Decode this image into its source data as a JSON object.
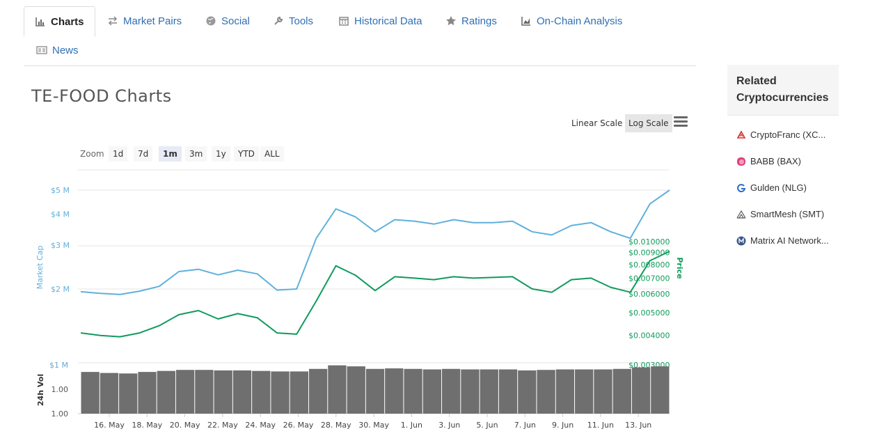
{
  "tabs": [
    {
      "label": "Charts",
      "icon": "bar-chart-icon",
      "active": true
    },
    {
      "label": "Market Pairs",
      "icon": "exchange-icon"
    },
    {
      "label": "Social",
      "icon": "globe-icon"
    },
    {
      "label": "Tools",
      "icon": "wrench-icon"
    },
    {
      "label": "Historical Data",
      "icon": "calendar-icon"
    },
    {
      "label": "Ratings",
      "icon": "star-icon"
    },
    {
      "label": "On-Chain Analysis",
      "icon": "area-chart-icon"
    },
    {
      "label": "News",
      "icon": "newspaper-icon"
    }
  ],
  "page_title": "TE-FOOD Charts",
  "scale": {
    "linear": "Linear Scale",
    "log": "Log Scale",
    "selected": "log"
  },
  "zoom": {
    "label": "Zoom",
    "options": [
      "1d",
      "7d",
      "1m",
      "3m",
      "1y",
      "YTD",
      "ALL"
    ],
    "selected": "1m"
  },
  "sidebar": {
    "title": "Related Cryptocurrencies",
    "items": [
      {
        "label": "CryptoFranc (XC...",
        "icon": "cryptofranc-icon",
        "color": "#d0342c"
      },
      {
        "label": "BABB (BAX)",
        "icon": "babb-icon",
        "color": "#e0407a"
      },
      {
        "label": "Gulden (NLG)",
        "icon": "gulden-icon",
        "color": "#2b6cc4"
      },
      {
        "label": "SmartMesh (SMT)",
        "icon": "smartmesh-icon",
        "color": "#555555"
      },
      {
        "label": "Matrix AI Network...",
        "icon": "matrix-ai-icon",
        "color": "#3a5a8a"
      }
    ]
  },
  "chart_data": {
    "type": "line",
    "scale": "log",
    "colors": {
      "market_cap": "#5fb0dc",
      "price": "#0f9a5c",
      "volume": "#6f6f6f"
    },
    "x_ticks": [
      "16. May",
      "18. May",
      "20. May",
      "22. May",
      "24. May",
      "26. May",
      "28. May",
      "30. May",
      "1. Jun",
      "3. Jun",
      "5. Jun",
      "7. Jun",
      "9. Jun",
      "11. Jun",
      "13. Jun"
    ],
    "left_axis": {
      "label": "Market Cap",
      "ticks": [
        "$5 M",
        "$4 M",
        "$3 M",
        "$2 M"
      ]
    },
    "right_axis": {
      "label": "Price",
      "ticks": [
        "$0.010000",
        "$0.009000",
        "$0.008000",
        "$0.007000",
        "$0.006000",
        "$0.005000",
        "$0.004000",
        "$0.003000"
      ]
    },
    "volume_axis": {
      "label": "24h Vol",
      "ticks": [
        "$1 M",
        "1.00",
        "1.00"
      ]
    },
    "x": [
      "15. May",
      "16. May",
      "17. May",
      "18. May",
      "19. May",
      "20. May",
      "21. May",
      "22. May",
      "23. May",
      "24. May",
      "25. May",
      "26. May",
      "27. May",
      "28. May",
      "29. May",
      "30. May",
      "31. May",
      "1. Jun",
      "2. Jun",
      "3. Jun",
      "4. Jun",
      "5. Jun",
      "6. Jun",
      "7. Jun",
      "8. Jun",
      "9. Jun",
      "10. Jun",
      "11. Jun",
      "12. Jun",
      "13. Jun",
      "14. Jun"
    ],
    "series": [
      {
        "name": "Market Cap",
        "axis": "left",
        "values": [
          1.95,
          1.92,
          1.9,
          1.96,
          2.05,
          2.35,
          2.4,
          2.28,
          2.38,
          2.3,
          1.98,
          2.0,
          3.2,
          4.2,
          3.9,
          3.4,
          3.8,
          3.75,
          3.65,
          3.8,
          3.7,
          3.7,
          3.75,
          3.4,
          3.3,
          3.6,
          3.7,
          3.4,
          3.2,
          4.4,
          5.0
        ]
      },
      {
        "name": "Price",
        "axis": "right",
        "values": [
          0.0041,
          0.004,
          0.00395,
          0.0041,
          0.0044,
          0.0049,
          0.0051,
          0.0047,
          0.00495,
          0.00475,
          0.0041,
          0.00405,
          0.0056,
          0.0079,
          0.0072,
          0.0062,
          0.0071,
          0.007,
          0.0069,
          0.0071,
          0.007,
          0.00705,
          0.0071,
          0.0063,
          0.0061,
          0.0069,
          0.007,
          0.0064,
          0.0061,
          0.0083,
          0.0091
        ]
      },
      {
        "name": "24h Vol",
        "axis": "volume",
        "values": [
          0.82,
          0.8,
          0.79,
          0.82,
          0.84,
          0.86,
          0.86,
          0.85,
          0.85,
          0.84,
          0.83,
          0.83,
          0.88,
          0.95,
          0.93,
          0.88,
          0.89,
          0.88,
          0.87,
          0.88,
          0.87,
          0.87,
          0.87,
          0.85,
          0.86,
          0.87,
          0.87,
          0.87,
          0.88,
          0.91,
          0.93
        ]
      }
    ]
  }
}
